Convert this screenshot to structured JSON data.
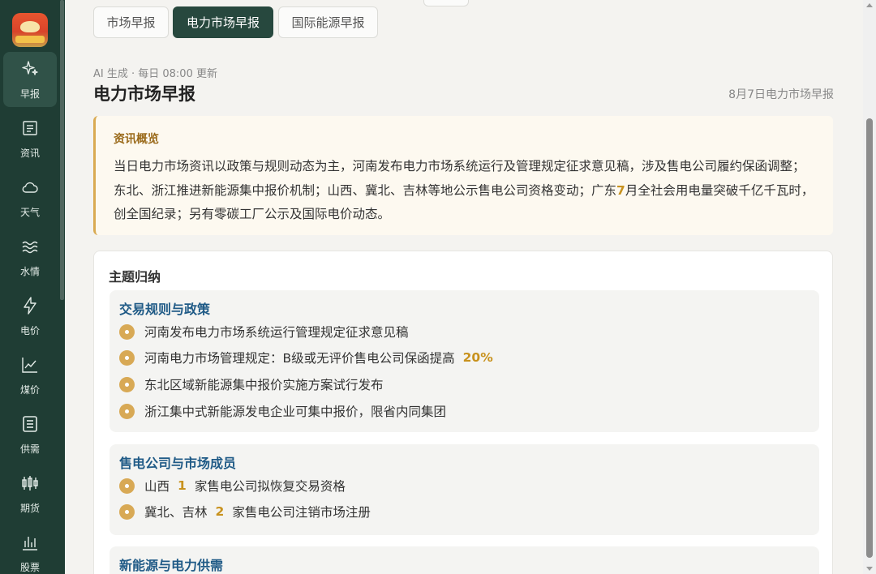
{
  "sidebar": {
    "items": [
      {
        "label": "早报",
        "icon": "sparkle-icon",
        "active": true
      },
      {
        "label": "资讯",
        "icon": "news-icon"
      },
      {
        "label": "天气",
        "icon": "cloud-icon"
      },
      {
        "label": "水情",
        "icon": "water-icon"
      },
      {
        "label": "电价",
        "icon": "lightning-icon"
      },
      {
        "label": "煤价",
        "icon": "line-chart-icon"
      },
      {
        "label": "供需",
        "icon": "document-icon"
      },
      {
        "label": "期货",
        "icon": "candlestick-icon"
      },
      {
        "label": "股票",
        "icon": "bar-chart-icon"
      }
    ]
  },
  "tabs": [
    {
      "label": "市场早报"
    },
    {
      "label": "电力市场早报",
      "active": true
    },
    {
      "label": "国际能源早报"
    }
  ],
  "header": {
    "meta": "AI 生成 · 每日 08:00 更新",
    "title": "电力市场早报",
    "date_label": "8月7日电力市场早报"
  },
  "summary": {
    "heading": "资讯概览",
    "text_before": "当日电力市场资讯以政策与规则动态为主，河南发布电力市场系统运行及管理规定征求意见稿，涉及售电公司履约保函调整；东北、浙江推进新能源集中报价机制；山西、冀北、吉林等地公示售电公司资格变动；广东",
    "highlight": "7",
    "text_after": "月全社会用电量突破千亿千瓦时，创全国纪录；另有零碳工厂公示及国际电价动态。"
  },
  "topics": {
    "title": "主题归纳",
    "groups": [
      {
        "heading": "交易规则与政策",
        "items": [
          {
            "text": "河南发布电力市场系统运行管理规定征求意见稿"
          },
          {
            "text": "河南电力市场管理规定：B级或无评价售电公司保函提高",
            "pct": "20%"
          },
          {
            "text": "东北区域新能源集中报价实施方案试行发布"
          },
          {
            "text": "浙江集中式新能源发电企业可集中报价，限省内同集团"
          }
        ]
      },
      {
        "heading": "售电公司与市场成员",
        "items": [
          {
            "prefix": "山西",
            "num": "1",
            "suffix": "家售电公司拟恢复交易资格"
          },
          {
            "prefix": "冀北、吉林",
            "num": "2",
            "suffix": "家售电公司注销市场注册"
          }
        ]
      },
      {
        "heading": "新能源与电力供需",
        "items": []
      }
    ]
  },
  "colors": {
    "sidebar_bg": "#1f3d34",
    "active_tab": "#27483e",
    "accent_gold": "#c8921e",
    "topic_heading": "#1f5a86"
  }
}
